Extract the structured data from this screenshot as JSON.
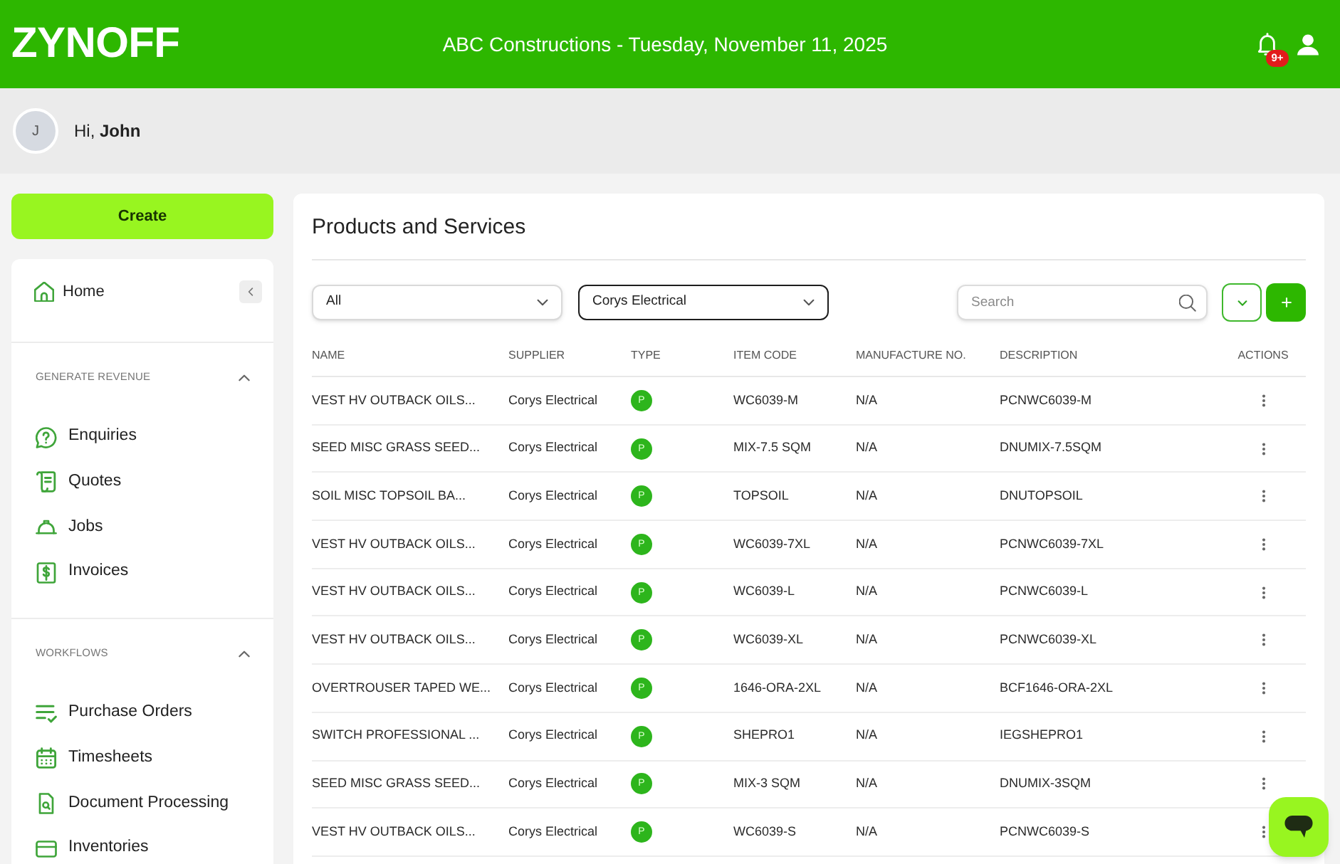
{
  "header": {
    "logo": "ZYNOFF",
    "title": "ABC Constructions - Tuesday, November 11, 2025",
    "notification_count": "9+"
  },
  "user_bar": {
    "avatar_initial": "J",
    "greeting": "Hi, **John**"
  },
  "sidebar": {
    "create_button": "Create",
    "home": "Home",
    "sections": [
      {
        "title": "GENERATE REVENUE",
        "expanded": true,
        "items": [
          "Enquiries",
          "Quotes",
          "Jobs",
          "Invoices"
        ]
      },
      {
        "title": "WORKFLOWS",
        "expanded": true,
        "items": [
          "Purchase Orders",
          "Timesheets",
          "Document Processing",
          "Inventories"
        ]
      }
    ]
  },
  "products": {
    "title": "Products and Services",
    "filters": [
      {
        "value": "All",
        "focused": false
      },
      {
        "value": "Corys Electrical",
        "focused": true
      }
    ],
    "search": {
      "placeholder": "Search"
    },
    "table": {
      "columns": [
        "NAME",
        "SUPPLIER",
        "TYPE",
        "ITEM CODE",
        "MANUFACTURE NO.",
        "DESCRIPTION",
        "ACTIONS"
      ],
      "rows": [
        {
          "name": "VEST HV OUTBACK OILS...",
          "supplier": "Corys Electrical",
          "type": "P",
          "item_code": "WC6039-M",
          "manufacture_no": "N/A",
          "description": "PCNWC6039-M"
        },
        {
          "name": "SEED MISC GRASS SEED...",
          "supplier": "Corys Electrical",
          "type": "P",
          "item_code": "MIX-7.5 SQM",
          "manufacture_no": "N/A",
          "description": "DNUMIX-7.5SQM"
        },
        {
          "name": "SOIL MISC TOPSOIL BA...",
          "supplier": "Corys Electrical",
          "type": "P",
          "item_code": "TOPSOIL",
          "manufacture_no": "N/A",
          "description": "DNUTOPSOIL"
        },
        {
          "name": "VEST HV OUTBACK OILS...",
          "supplier": "Corys Electrical",
          "type": "P",
          "item_code": "WC6039-7XL",
          "manufacture_no": "N/A",
          "description": "PCNWC6039-7XL"
        },
        {
          "name": "VEST HV OUTBACK OILS...",
          "supplier": "Corys Electrical",
          "type": "P",
          "item_code": "WC6039-L",
          "manufacture_no": "N/A",
          "description": "PCNWC6039-L"
        },
        {
          "name": "VEST HV OUTBACK OILS...",
          "supplier": "Corys Electrical",
          "type": "P",
          "item_code": "WC6039-XL",
          "manufacture_no": "N/A",
          "description": "PCNWC6039-XL"
        },
        {
          "name": "OVERTROUSER TAPED WE...",
          "supplier": "Corys Electrical",
          "type": "P",
          "item_code": "1646-ORA-2XL",
          "manufacture_no": "N/A",
          "description": "BCF1646-ORA-2XL"
        },
        {
          "name": "SWITCH PROFESSIONAL ...",
          "supplier": "Corys Electrical",
          "type": "P",
          "item_code": "SHEPRO1",
          "manufacture_no": "N/A",
          "description": "IEGSHEPRO1"
        },
        {
          "name": "SEED MISC GRASS SEED...",
          "supplier": "Corys Electrical",
          "type": "P",
          "item_code": "MIX-3 SQM",
          "manufacture_no": "N/A",
          "description": "DNUMIX-3SQM"
        },
        {
          "name": "VEST HV OUTBACK OILS...",
          "supplier": "Corys Electrical",
          "type": "P",
          "item_code": "WC6039-S",
          "manufacture_no": "N/A",
          "description": "PCNWC6039-S"
        }
      ]
    }
  }
}
